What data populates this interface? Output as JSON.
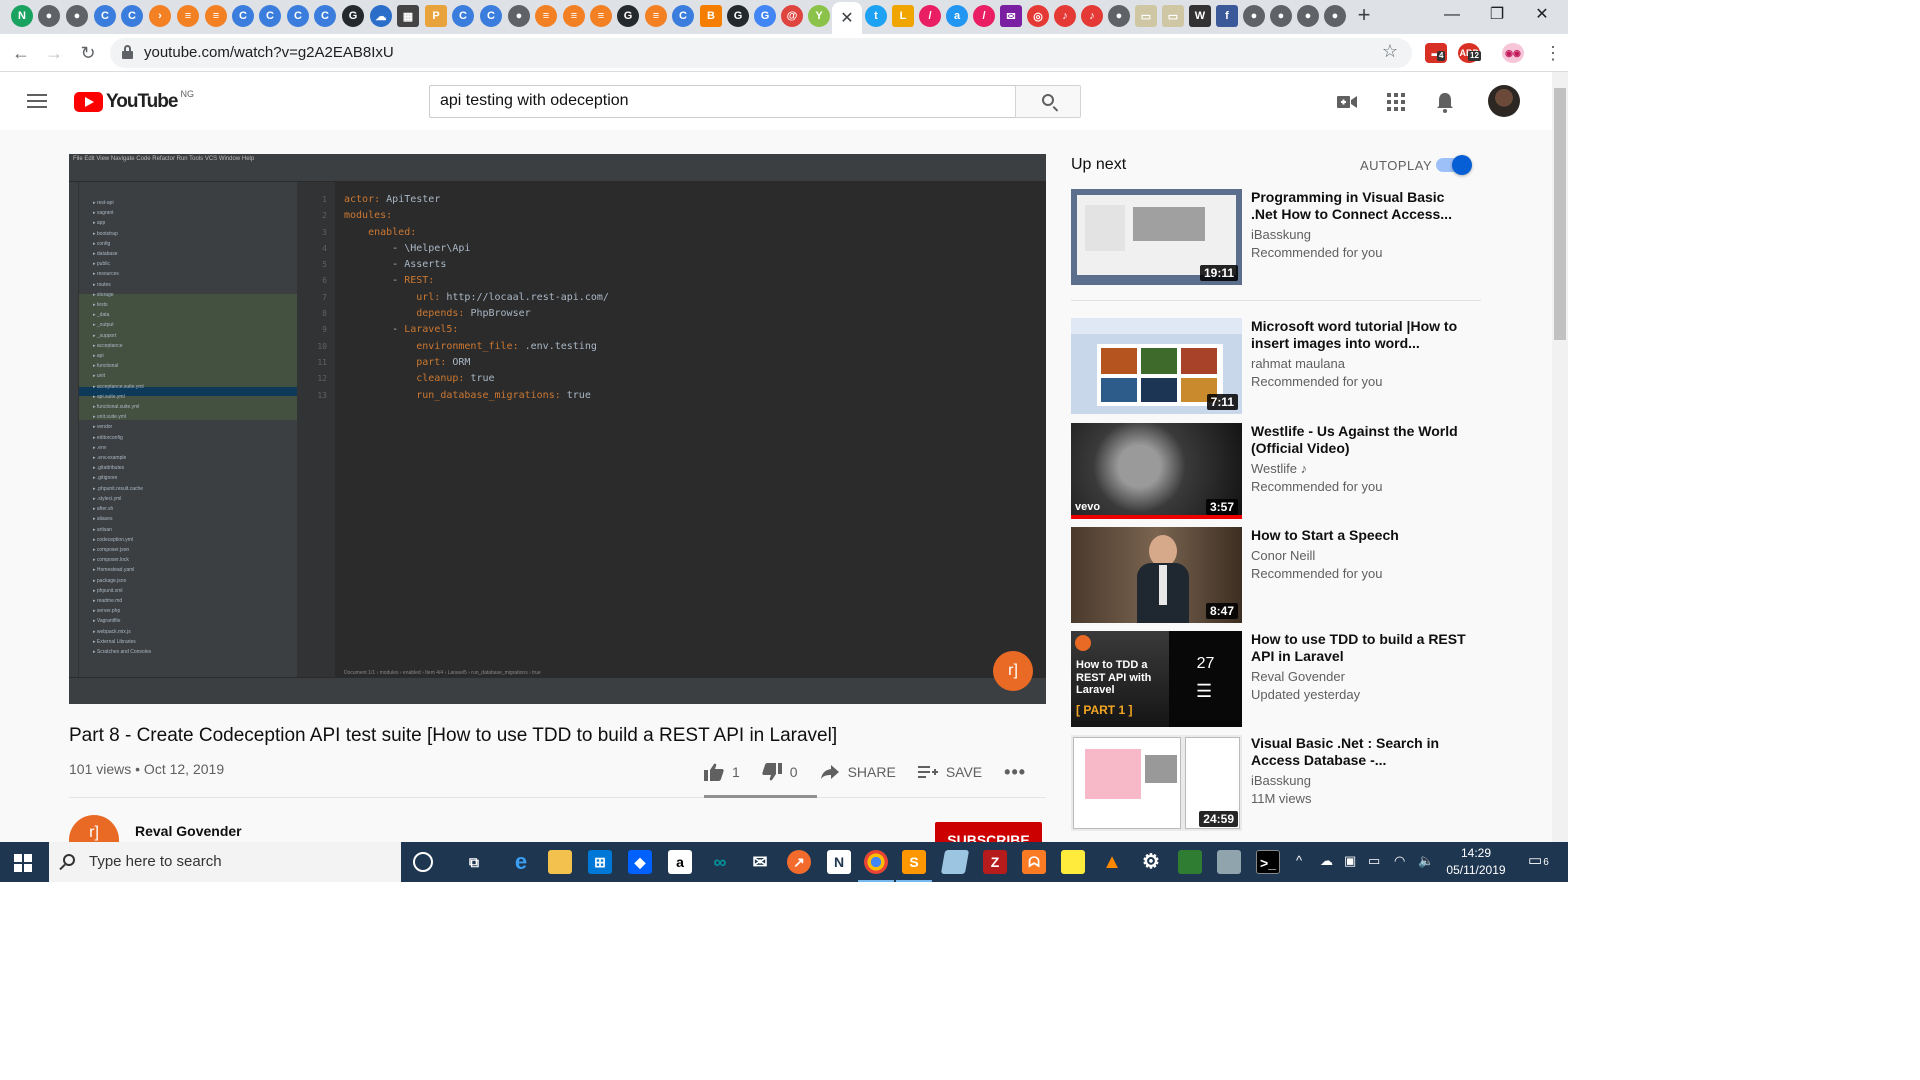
{
  "browser": {
    "url": "youtube.com/watch?v=g2A2EAB8IxU"
  },
  "youtube": {
    "logo_text": "YouTube",
    "country": "NG",
    "search_value": "api testing with odeception"
  },
  "video": {
    "title": "Part 8 - Create Codeception API test suite [How to use TDD to build a REST API in Laravel]",
    "meta": "101 views • Oct 12, 2019",
    "likes": "1",
    "dislikes": "0",
    "share_label": "SHARE",
    "save_label": "SAVE",
    "channel": "Reval Govender",
    "subscribe_label": "SUBSCRIBE",
    "ide": {
      "line_numbers": [
        "1",
        "2",
        "3",
        "4",
        "5",
        "6",
        "7",
        "8",
        "9",
        "10",
        "11",
        "12",
        "13"
      ],
      "code_lines": [
        [
          "k",
          "actor: ",
          "v",
          "ApiTester"
        ],
        [
          "k",
          "modules:"
        ],
        [
          "k",
          "    enabled:"
        ],
        [
          "v",
          "        - \\Helper\\Api"
        ],
        [
          "v",
          "        - Asserts"
        ],
        [
          "v",
          "        - ",
          "k",
          "REST:"
        ],
        [
          "k",
          "            url: ",
          "v",
          "http://locaal.rest-api.com/"
        ],
        [
          "k",
          "            depends: ",
          "v",
          "PhpBrowser"
        ],
        [
          "v",
          "        - ",
          "k",
          "Laravel5:"
        ],
        [
          "k",
          "            environment_file: ",
          "v",
          ".env.testing"
        ],
        [
          "k",
          "            part: ",
          "v",
          "ORM"
        ],
        [
          "k",
          "            cleanup: ",
          "v",
          "true"
        ],
        [
          "k",
          "            run_database_migrations: ",
          "v",
          "true"
        ]
      ],
      "tree_items": [
        "rest-api",
        "vagrant",
        "app",
        "bootstrap",
        "config",
        "database",
        "public",
        "resources",
        "routes",
        "storage",
        "tests",
        "_data",
        "_output",
        "_support",
        "acceptance",
        "api",
        "functional",
        "unit",
        "acceptance.suite.yml",
        "api.suite.yml",
        "functional.suite.yml",
        "unit.suite.yml",
        "vendor",
        "editorconfig",
        ".env",
        ".env.example",
        ".gitattributes",
        ".gitignore",
        ".phpunit.result.cache",
        ".styleci.yml",
        "after.sh",
        "aliases",
        "artisan",
        "codeception.yml",
        "composer.json",
        "composer.lock",
        "Homestead.yaml",
        "package.json",
        "phpunit.xml",
        "readme.md",
        "server.php",
        "Vagrantfile",
        "webpack.mix.js",
        "External Libraries",
        "Scratches and Consoles"
      ],
      "breadcrumb": "Document 1/1  ›  modules  ›  enabled  ›  Item 4/4  ›  Laravel5  ›  run_database_migrations  ›  true"
    }
  },
  "sidebar": {
    "up_next": "Up next",
    "autoplay": "AUTOPLAY",
    "items": [
      {
        "title": "Programming in Visual Basic .Net How to Connect Access...",
        "channel": "iBasskung",
        "meta": "Recommended for you",
        "duration": "19:11"
      },
      {
        "title": "Microsoft word tutorial |How to insert images into word...",
        "channel": "rahmat maulana",
        "meta": "Recommended for you",
        "duration": "7:11"
      },
      {
        "title": "Westlife - Us Against the World (Official Video)",
        "channel": "Westlife ♪",
        "meta": "Recommended for you",
        "duration": "3:57"
      },
      {
        "title": "How to Start a Speech",
        "channel": "Conor Neill",
        "meta": "Recommended for you",
        "duration": "8:47"
      },
      {
        "title": "How to use TDD to build a REST API in Laravel",
        "channel": "Reval Govender",
        "meta": "Updated yesterday",
        "playlist_count": "27",
        "thumb_text": "How to TDD a REST API with Laravel",
        "thumb_part": "[ PART 1 ]"
      },
      {
        "title": "Visual Basic .Net : Search in Access Database -...",
        "channel": "iBasskung",
        "meta": "11M views",
        "duration": "24:59"
      }
    ]
  },
  "taskbar": {
    "search_placeholder": "Type here to search",
    "time": "14:29",
    "date": "05/11/2019",
    "notifications": "6"
  },
  "extensions": {
    "badge1": "4",
    "badge2": "12"
  }
}
